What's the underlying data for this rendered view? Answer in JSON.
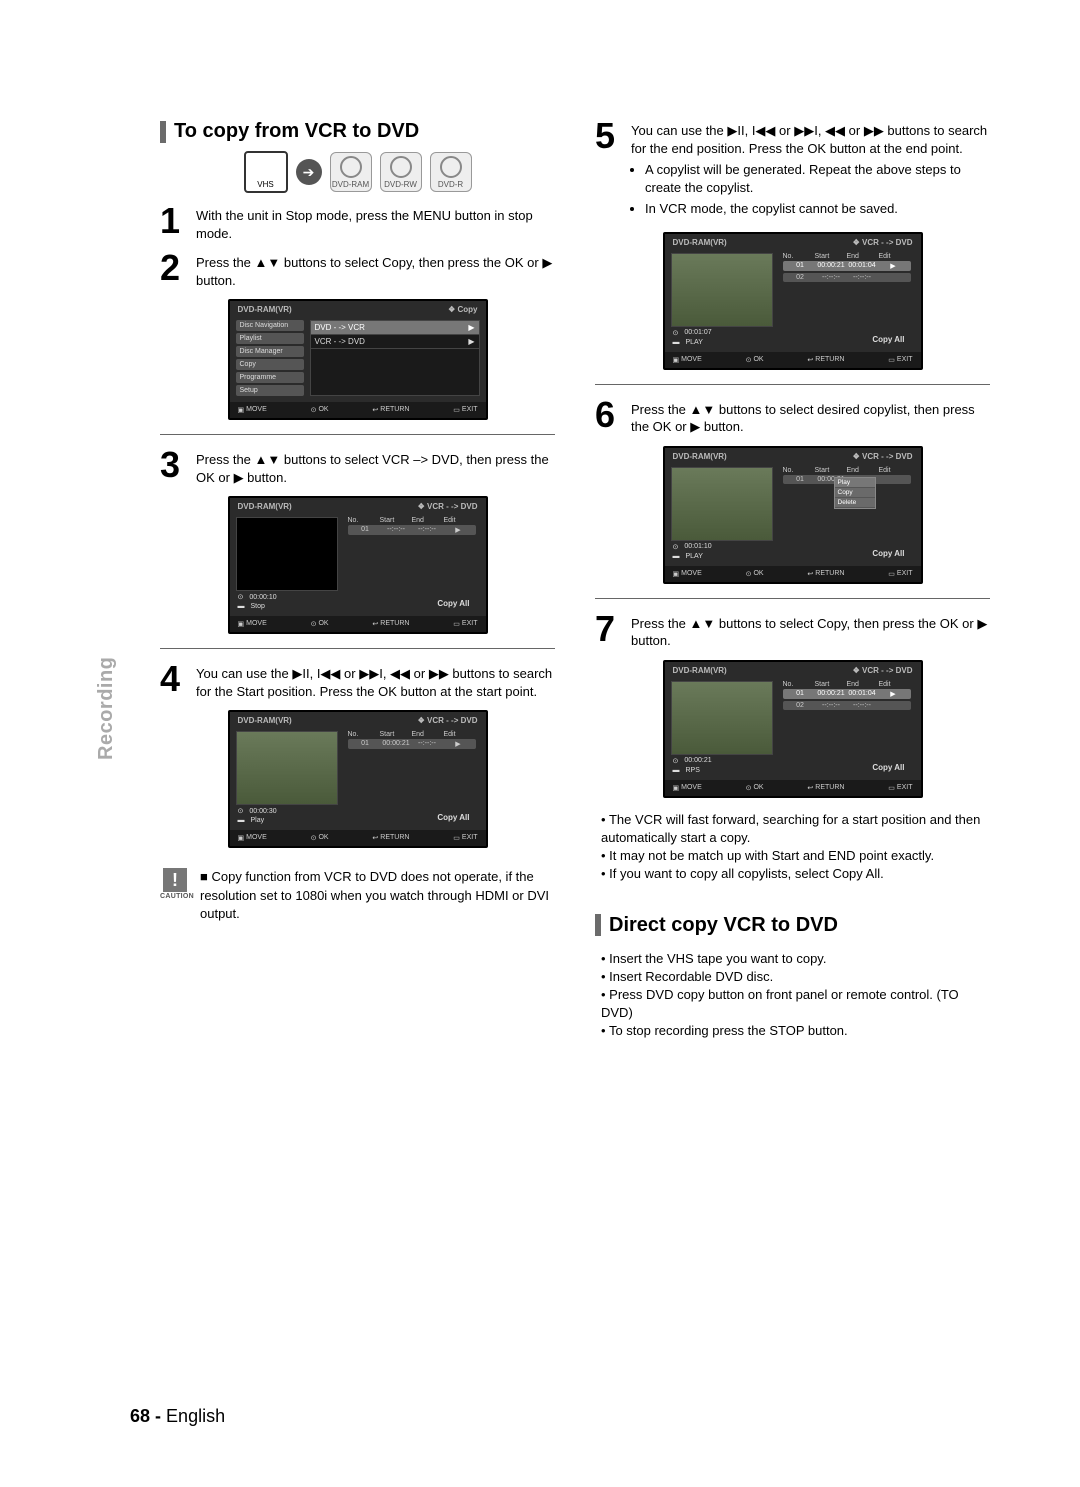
{
  "sideLabel": "Recording",
  "pageFooter": {
    "num": "68 -",
    "lang": "English"
  },
  "sec1": {
    "title": "To copy from VCR to DVD",
    "media": {
      "vhs": "VHS",
      "discs": [
        "DVD-RAM",
        "DVD-RW",
        "DVD-R"
      ]
    }
  },
  "sec2": {
    "title": "Direct copy VCR to DVD"
  },
  "directBullets": [
    "Insert the VHS tape you want to copy.",
    "Insert Recordable DVD disc.",
    "Press DVD copy button on front panel or remote control. (TO DVD)",
    "To stop recording press the STOP button."
  ],
  "afterStep7Bullets": [
    "The VCR will fast forward, searching for a start position and then automatically start a copy.",
    "It may not be match up with Start and END point exactly.",
    "If you want to copy all copylists, select Copy All."
  ],
  "caution": {
    "label": "CAUTION",
    "text": "Copy function from VCR to DVD does not operate, if the resolution set to 1080i when you watch through HDMI or DVI output."
  },
  "steps": {
    "s1": "With the unit in Stop mode, press the MENU button in stop mode.",
    "s2": "Press the ▲▼ buttons to select Copy, then press the OK or ▶ button.",
    "s3": "Press the ▲▼ buttons to select VCR –> DVD, then press the OK or ▶ button.",
    "s4": "You can use the ▶II, I◀◀ or ▶▶I, ◀◀ or ▶▶ buttons to search for the Start position. Press the OK button at the start point.",
    "s5": {
      "main": "You can use the ▶II, I◀◀ or ▶▶I, ◀◀ or ▶▶ buttons to search for the end position. Press the OK button at the end point.",
      "b1": "A copylist will be generated. Repeat the above steps to create the copylist.",
      "b2": "In VCR mode, the copylist cannot be saved."
    },
    "s6": "Press the ▲▼ buttons to select desired copylist, then press the OK or ▶ button.",
    "s7": "Press the ▲▼ buttons to select Copy, then press the OK or ▶ button."
  },
  "osd": {
    "header_left": "DVD-RAM(VR)",
    "copy_label": "❖ Copy",
    "vcr_dvd_label": "❖ VCR - -> DVD",
    "menu_items": [
      "Disc Navigation",
      "Playlist",
      "Disc Manager",
      "Copy",
      "Programme",
      "Setup"
    ],
    "menu_options": [
      "DVD - -> VCR",
      "VCR - -> DVD"
    ],
    "table_head": [
      "No.",
      "Start",
      "End",
      "Edit"
    ],
    "copy_all": "Copy All",
    "footer": {
      "move": "MOVE",
      "ok": "OK",
      "return": "RETURN",
      "exit": "EXIT"
    },
    "s3_time": "00:00:10",
    "s3_status": "Stop",
    "s4_time": "00:00:30",
    "s4_status": "Play",
    "s4_row": [
      "01",
      "00:00:21",
      "--:--:--",
      "▶"
    ],
    "s5_time": "00:01:07",
    "s5_status": "PLAY",
    "s5_row1": [
      "01",
      "00:00:21",
      "00:01:04",
      "▶"
    ],
    "s5_row2": [
      "02",
      "--:--:--",
      "--:--:--"
    ],
    "s6_time": "00:01:10",
    "s6_status": "PLAY",
    "s6_row": [
      "01",
      "00:00:21"
    ],
    "s6_popup": [
      "Play",
      "Copy",
      "Delete"
    ],
    "s7_time": "00:00:21",
    "s7_status": "RPS",
    "s7_row1": [
      "01",
      "00:00:21",
      "00:01:04",
      "▶"
    ],
    "s7_row2": [
      "02",
      "--:--:--",
      "--:--:--"
    ]
  }
}
